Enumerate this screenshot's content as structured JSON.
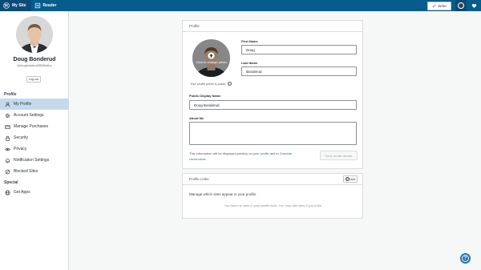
{
  "masterbar": {
    "my_site": "My Site",
    "reader": "Reader",
    "write": "Write",
    "colors": {
      "bar": "#065d8c",
      "active": "#0a4b78"
    }
  },
  "sidebar": {
    "user_name": "Doug Bonderud",
    "user_handle": "@dougbonderud58065a8cc",
    "logout": "Log out",
    "section_profile": "Profile",
    "section_special": "Special",
    "items": [
      {
        "label": "My Profile",
        "icon": "user-icon",
        "active": true
      },
      {
        "label": "Account Settings",
        "icon": "gear-icon"
      },
      {
        "label": "Manage Purchases",
        "icon": "credit-card-icon"
      },
      {
        "label": "Security",
        "icon": "lock-icon"
      },
      {
        "label": "Privacy",
        "icon": "eye-icon"
      },
      {
        "label": "Notification Settings",
        "icon": "bell-icon"
      },
      {
        "label": "Blocked Sites",
        "icon": "block-icon"
      }
    ],
    "special_items": [
      {
        "label": "Get Apps",
        "icon": "globe-icon"
      }
    ]
  },
  "profile": {
    "header": "Profile",
    "photo_overlay": "Click to change photo",
    "photo_note": "Your profile photo is public",
    "first_name_label": "First Name",
    "first_name_value": "Doug",
    "last_name_label": "Last Name",
    "last_name_value": "Bonderud",
    "display_name_label": "Public Display Name",
    "display_name_value": "Doug Bonderud",
    "about_label": "About Me",
    "about_value": "",
    "info_prefix": "This information will be displayed publicly on ",
    "info_link1": "your profile",
    "info_mid": " and in ",
    "info_link2": "Gravatar Hovercards",
    "info_suffix": ".",
    "save_button": "Save profile details"
  },
  "profile_links": {
    "header": "Profile Links",
    "add_button": "Add",
    "description": "Manage which sites appear in your profile.",
    "empty": "You have no sites in your profile links. You may add sites if you'd like."
  },
  "accent_color": "#2271b1"
}
